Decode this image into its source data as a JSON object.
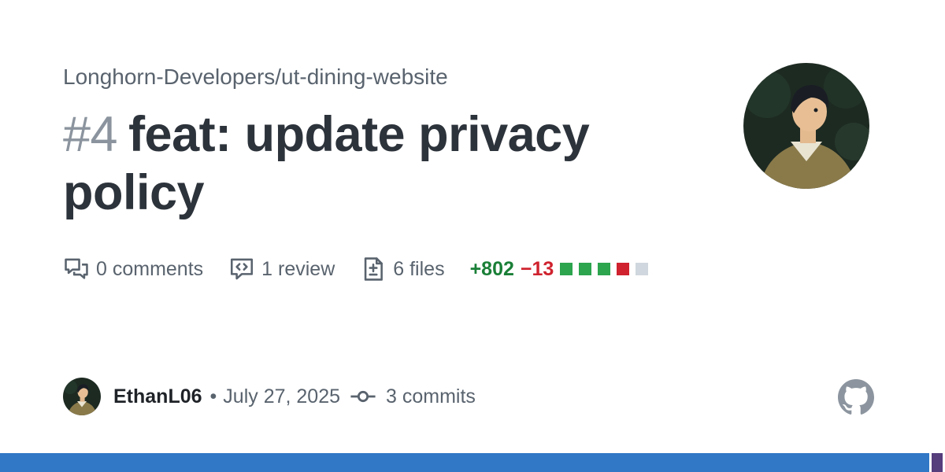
{
  "repo": "Longhorn-Developers/ut-dining-website",
  "pr": {
    "number": "#4",
    "title": "feat: update privacy policy"
  },
  "stats": {
    "comments": "0 comments",
    "reviews": "1 review",
    "files": "6 files",
    "additions": "+802",
    "deletions": "−13",
    "diff_blocks": [
      "#2da44e",
      "#2da44e",
      "#2da44e",
      "#cf222e",
      "#d0d7de"
    ]
  },
  "footer": {
    "author": "EthanL06",
    "separator": "•",
    "date": "July 27, 2025",
    "commits": "3 commits"
  },
  "icons": {
    "comments": "comment-discussion-icon",
    "review": "code-review-icon",
    "files": "file-diff-icon",
    "commits": "git-commit-icon",
    "brand": "github-mark-icon"
  },
  "language_bar": [
    "#3178c6",
    "#563d7c"
  ]
}
